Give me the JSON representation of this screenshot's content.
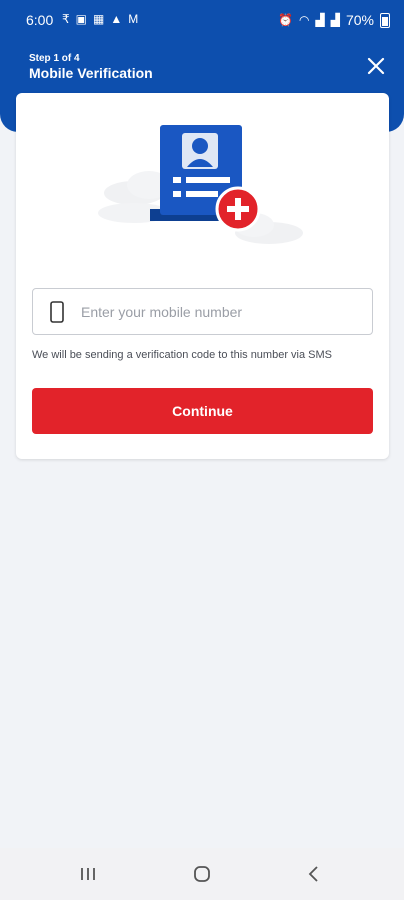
{
  "status_bar": {
    "time": "6:00",
    "battery": "70%",
    "left_icons": [
      "data-saver-icon",
      "gallery-icon",
      "qr-icon",
      "warning-icon",
      "gmail-icon"
    ],
    "right_icons": [
      "alarm-icon",
      "wifi-icon",
      "lte-icon",
      "signal-icon",
      "signal-icon",
      "battery-icon"
    ]
  },
  "header": {
    "step": "Step 1 of 4",
    "title": "Mobile Verification"
  },
  "form": {
    "placeholder": "Enter your mobile number",
    "value": "",
    "helper_text": "We will be sending a verification code to this number via SMS",
    "continue_label": "Continue"
  },
  "colors": {
    "header_bg": "#0d4fae",
    "accent_red": "#e2232a",
    "page_bg": "#f1f3f7"
  }
}
